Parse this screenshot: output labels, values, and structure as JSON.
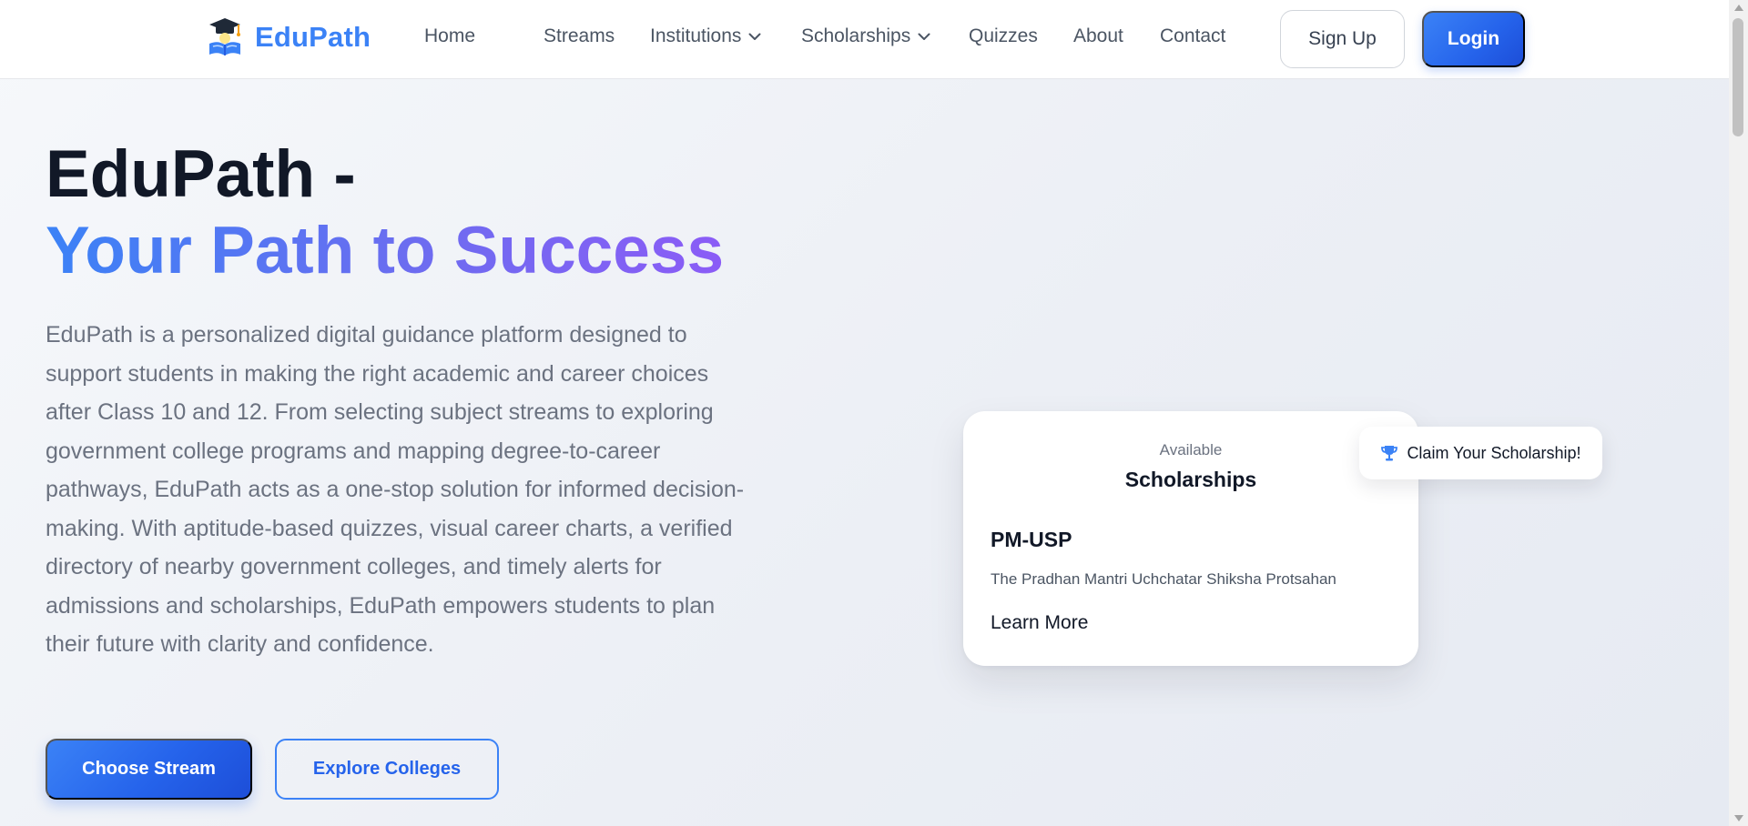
{
  "navbar": {
    "brand": "EduPath",
    "logo_icon": "graduation-cap-book-icon",
    "links": [
      {
        "label": "Home"
      },
      {
        "label": "Streams"
      },
      {
        "label": "Institutions",
        "dropdown": true
      },
      {
        "label": "Scholarships",
        "dropdown": true
      },
      {
        "label": "Quizzes"
      },
      {
        "label": "About"
      },
      {
        "label": "Contact"
      }
    ],
    "signup_label": "Sign Up",
    "login_label": "Login"
  },
  "hero": {
    "title_line1": "EduPath -",
    "title_line2": "Your Path to Success",
    "description": "EduPath is a personalized digital guidance platform designed to support students in making the right academic and career choices after Class 10 and 12. From selecting subject streams to exploring government college programs and mapping degree-to-career pathways, EduPath acts as a one-stop solution for informed decision-making. With aptitude-based quizzes, visual career charts, a verified directory of nearby government colleges, and timely alerts for admissions and scholarships, EduPath empowers students to plan their future with clarity and confidence.",
    "primary_button": "Choose Stream",
    "secondary_button": "Explore Colleges"
  },
  "scholarship_card": {
    "eyebrow": "Available",
    "heading": "Scholarships",
    "name": "PM-USP",
    "full_name": "The Pradhan Mantri Uchchatar Shiksha Protsahan",
    "link_label": "Learn More"
  },
  "claim_badge": {
    "icon": "trophy-icon",
    "label": "Claim Your Scholarship!"
  },
  "colors": {
    "accent": "#3b82f6",
    "accent_dark": "#1d4ed8",
    "gradient_end": "#8b5cf6",
    "text_dark": "#111827",
    "text_muted": "#6b7280"
  }
}
